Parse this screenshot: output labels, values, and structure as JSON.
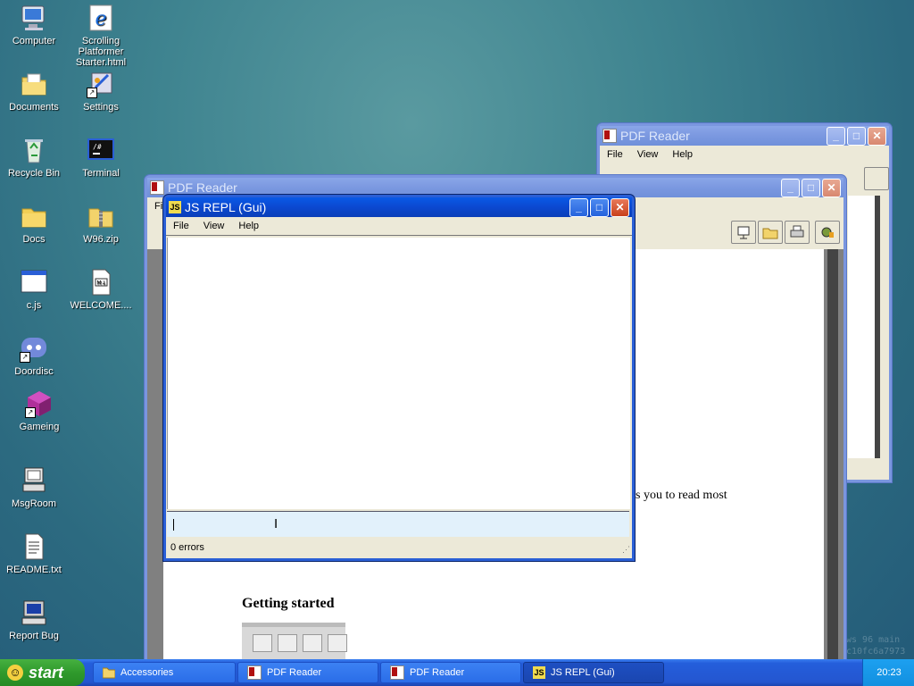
{
  "desktop_icons": [
    {
      "label": "Computer",
      "icon": "computer-icon"
    },
    {
      "label": "Scrolling Platformer Starter.html",
      "icon": "internet-explorer-icon"
    },
    {
      "label": "Documents",
      "icon": "documents-folder-icon"
    },
    {
      "label": "Settings",
      "icon": "settings-icon"
    },
    {
      "label": "Recycle Bin",
      "icon": "recycle-bin-icon"
    },
    {
      "label": "Terminal",
      "icon": "terminal-icon"
    },
    {
      "label": "Docs",
      "icon": "folder-icon"
    },
    {
      "label": "W96.zip",
      "icon": "zip-folder-icon"
    },
    {
      "label": "c.js",
      "icon": "window-file-icon"
    },
    {
      "label": "WELCOME....",
      "icon": "markdown-file-icon"
    },
    {
      "label": "Doordisc",
      "icon": "discord-icon"
    },
    {
      "label": "Gameing",
      "icon": "cube-icon"
    },
    {
      "label": "MsgRoom",
      "icon": "msgroom-icon"
    },
    {
      "label": "README.txt",
      "icon": "text-file-icon"
    },
    {
      "label": "Report Bug",
      "icon": "report-bug-icon"
    }
  ],
  "pdf_window_back": {
    "title": "PDF Reader",
    "menu": [
      "File",
      "View",
      "Help"
    ]
  },
  "pdf_window_front": {
    "title": "PDF Reader",
    "menu_partial": "Fi",
    "body_text_partial": "vs you to read most",
    "heading": "Getting started"
  },
  "repl_window": {
    "title": "JS REPL (Gui)",
    "menu": [
      "File",
      "View",
      "Help"
    ],
    "input_value": "",
    "status": "0 errors"
  },
  "watermark": {
    "line1": "ws 96 main",
    "line2": "c10fc6a7973"
  },
  "taskbar": {
    "start_label": "start",
    "tasks": [
      {
        "label": "Accessories",
        "icon": "folder-icon",
        "active": false
      },
      {
        "label": "PDF Reader",
        "icon": "pdf-icon",
        "active": false
      },
      {
        "label": "PDF Reader",
        "icon": "pdf-icon",
        "active": false
      },
      {
        "label": "JS REPL (Gui)",
        "icon": "js-icon",
        "active": true
      }
    ],
    "clock": "20:23"
  },
  "colors": {
    "title_active": "#0b48d0",
    "title_inactive": "#7b98e0",
    "repl_input_bg": "#e2f1fb",
    "taskbar": "#245edb",
    "start_green": "#2f9a2c"
  }
}
